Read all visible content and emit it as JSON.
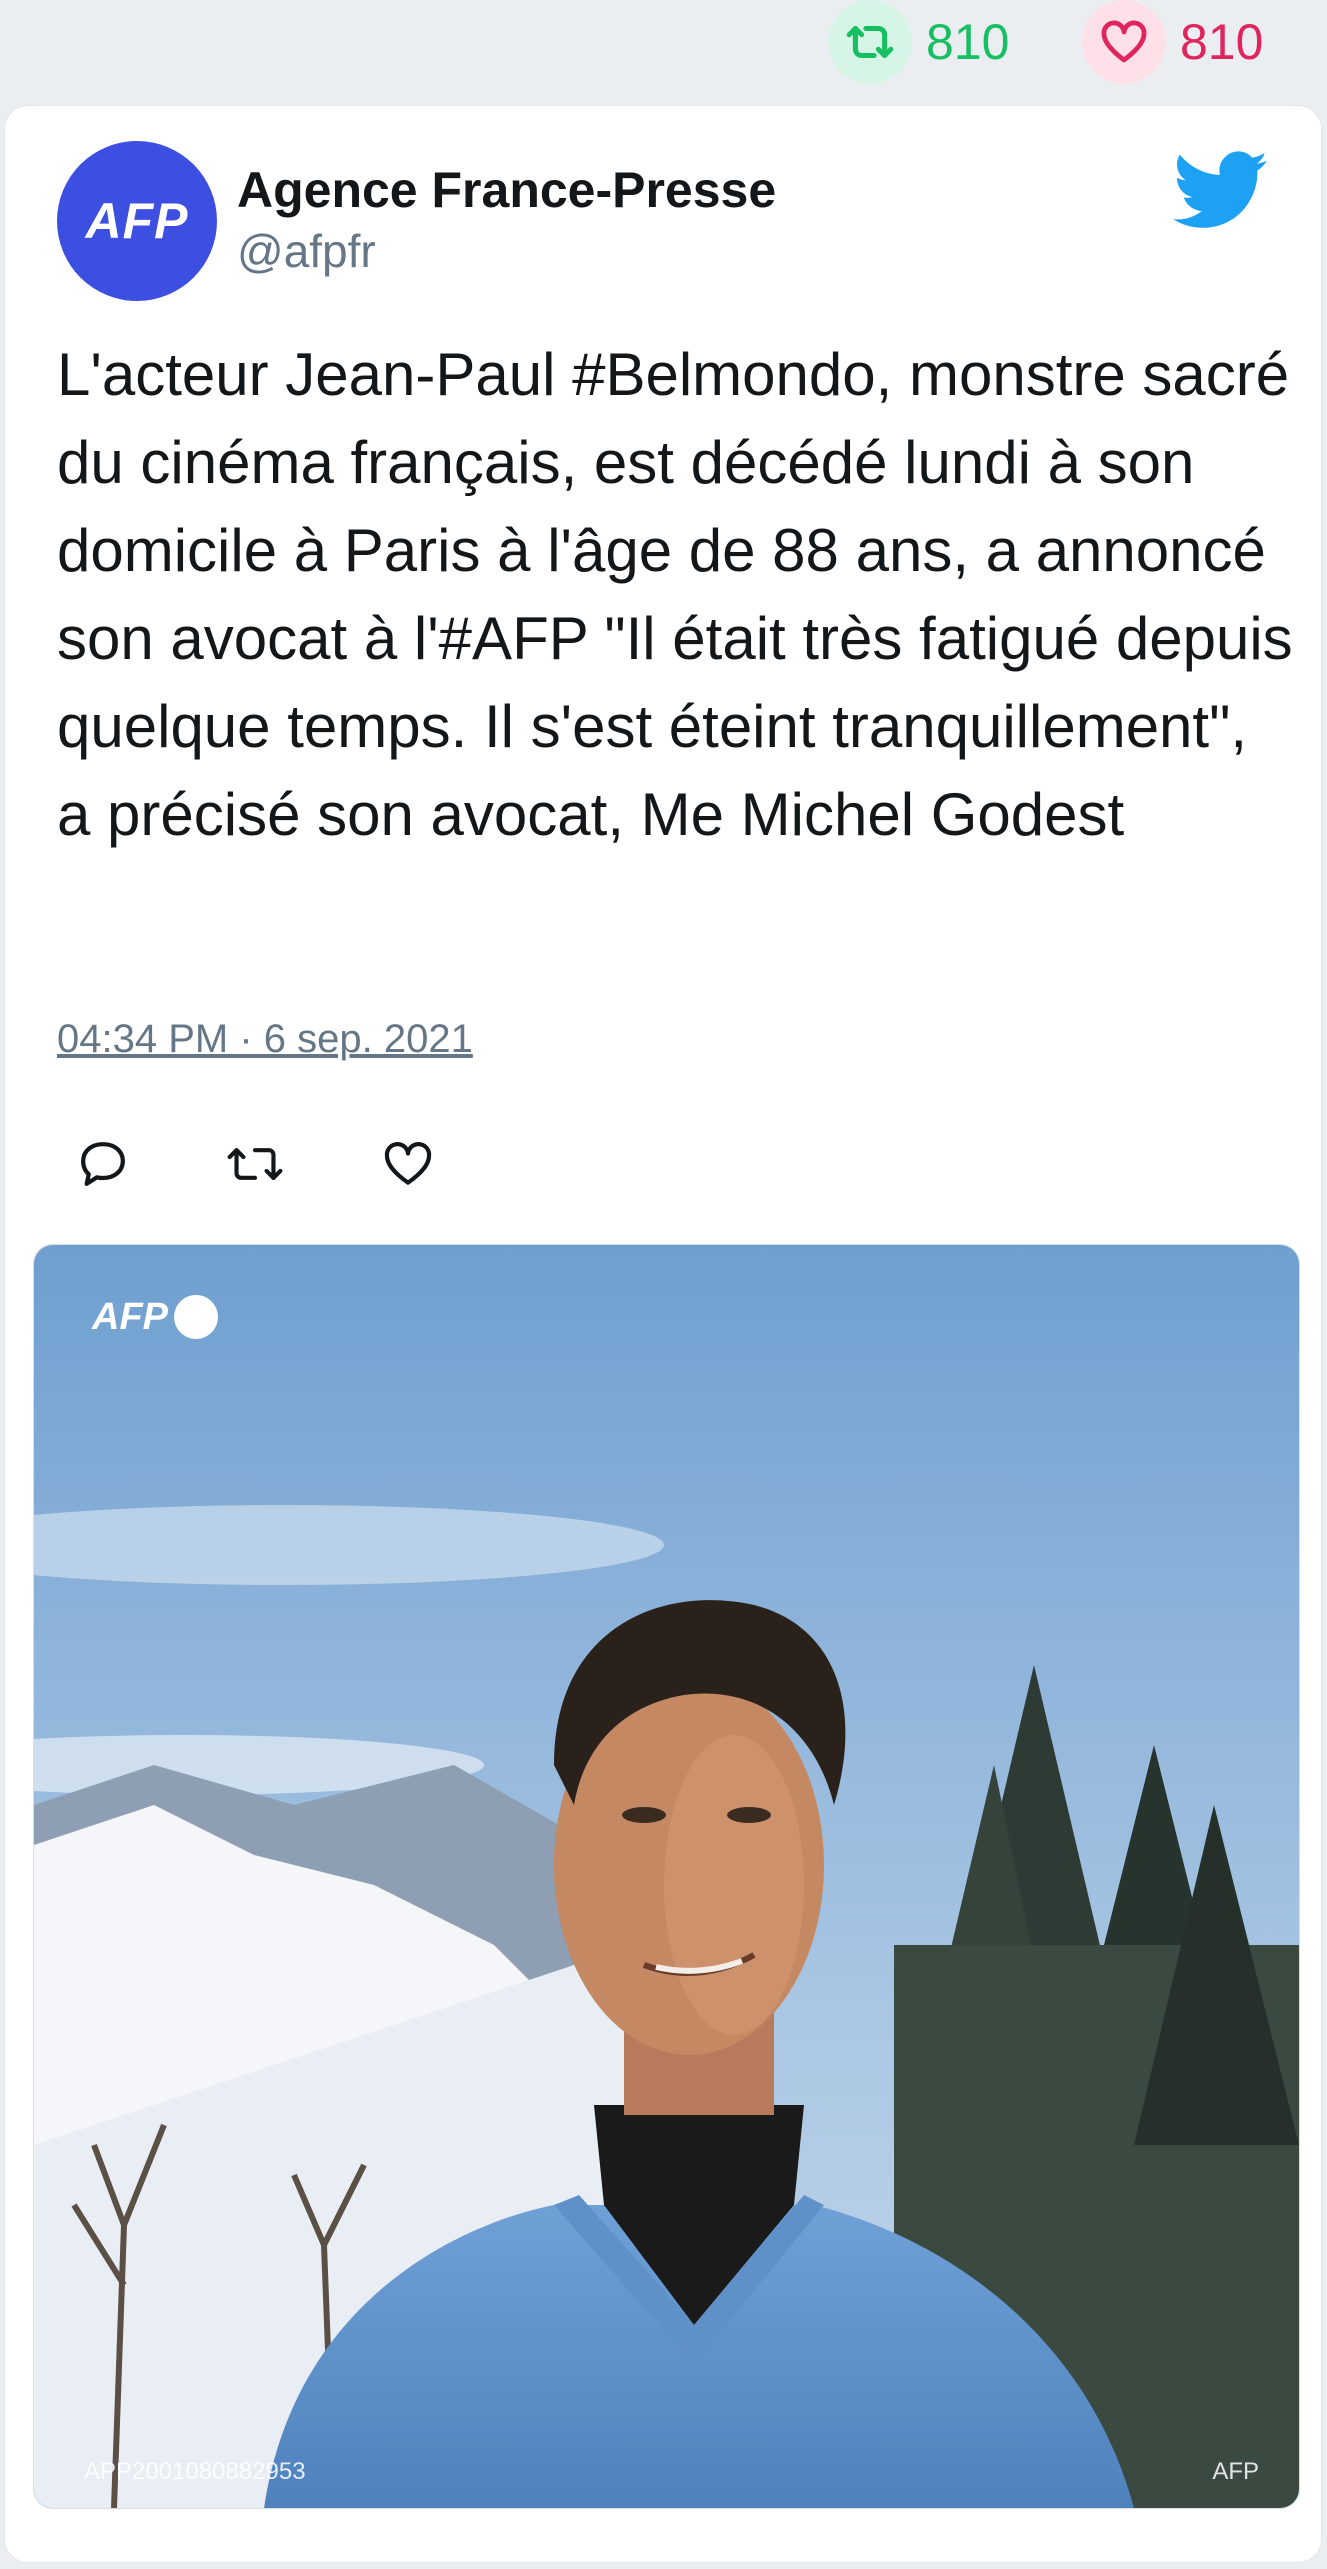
{
  "stats": {
    "retweet_count": "810",
    "like_count": "810",
    "retweet_color": "#17bf63",
    "like_color": "#e0245e"
  },
  "tweet": {
    "author_name": "Agence France-Presse",
    "author_handle": "@afpfr",
    "avatar_text": "AFP",
    "text": "L'acteur Jean-Paul #Belmondo, monstre sacré du cinéma français, est décédé lundi à son domicile à Paris à l'âge de 88 ans, a annoncé son avocat à l'#AFP \"Il était très fatigué depuis quelque temps. Il s'est éteint tranquillement\", a précisé son avocat, Me Michel Godest",
    "timestamp": "04:34 PM · 6 sep. 2021"
  },
  "actions": [
    {
      "icon": "reply-icon"
    },
    {
      "icon": "retweet-icon"
    },
    {
      "icon": "like-icon"
    }
  ],
  "photo": {
    "watermark_logo": "AFP",
    "watermark_id": "APP2001080882953",
    "watermark_right": "AFP"
  },
  "colors": {
    "brand_avatar": "#3c4fe0",
    "twitter_blue": "#1da1f2",
    "text": "#14171a",
    "muted": "#657786"
  }
}
